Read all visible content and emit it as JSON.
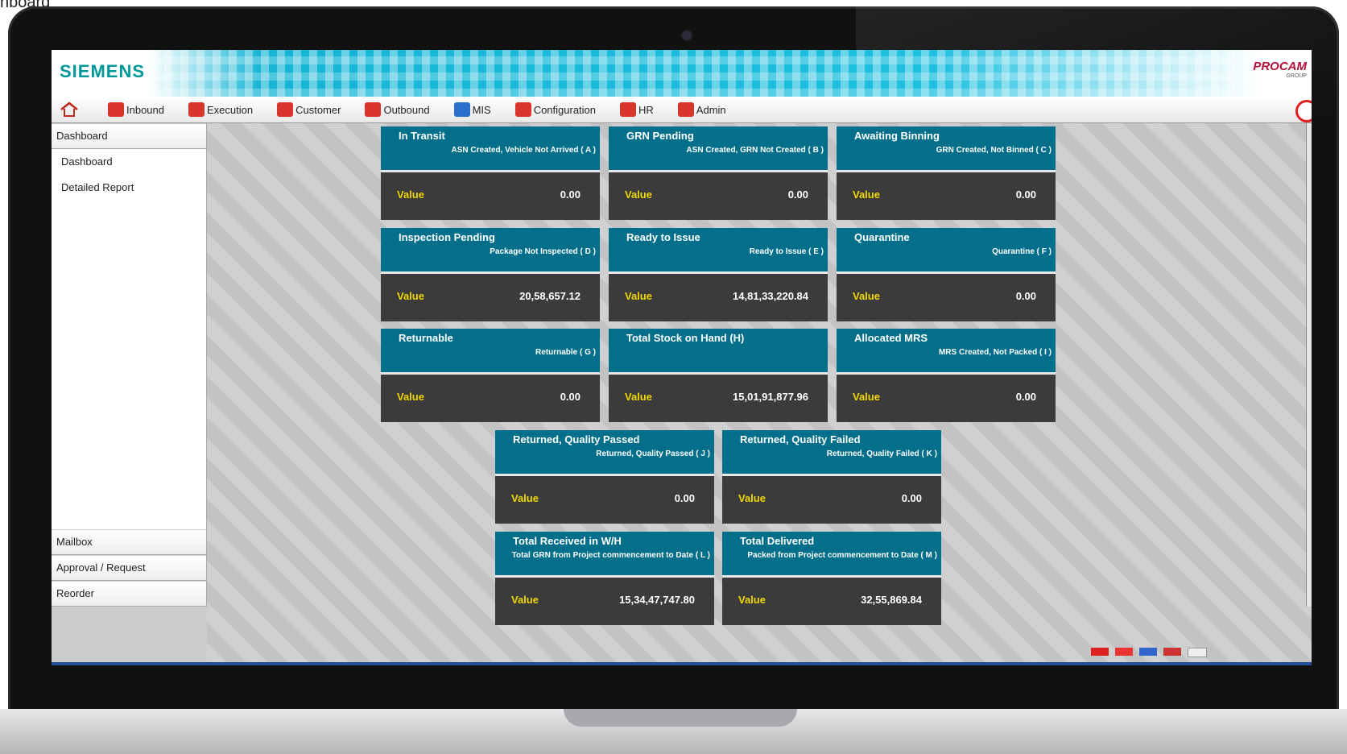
{
  "caption": "nboard",
  "app": {
    "brand_left": "SIEMENS",
    "brand_right": "PROCAM",
    "brand_right_sub": "GROUP"
  },
  "menu": {
    "items": [
      {
        "label": "Inbound",
        "icon": "truck-icon",
        "color": "#d9342b"
      },
      {
        "label": "Execution",
        "icon": "execution-icon",
        "color": "#d9342b"
      },
      {
        "label": "Customer",
        "icon": "users-icon",
        "color": "#d9342b"
      },
      {
        "label": "Outbound",
        "icon": "outbound-icon",
        "color": "#d9342b"
      },
      {
        "label": "MIS",
        "icon": "bar-chart-icon",
        "color": "#2a6fc9"
      },
      {
        "label": "Configuration",
        "icon": "user-config-icon",
        "color": "#d9342b"
      },
      {
        "label": "HR",
        "icon": "hr-users-icon",
        "color": "#d9342b"
      },
      {
        "label": "Admin",
        "icon": "admin-user-icon",
        "color": "#d9342b"
      }
    ]
  },
  "sidebar": {
    "header": "Dashboard",
    "links": [
      "Dashboard",
      "Detailed Report"
    ],
    "bottom": [
      "Mailbox",
      "Approval / Request",
      "Reorder"
    ]
  },
  "value_label": "Value",
  "cards": [
    {
      "title": "In Transit",
      "sub": "ASN Created, Vehicle Not Arrived ( A )",
      "value": "0.00"
    },
    {
      "title": "GRN Pending",
      "sub": "ASN Created, GRN Not Created ( B )",
      "value": "0.00"
    },
    {
      "title": "Awaiting Binning",
      "sub": "GRN Created, Not Binned ( C )",
      "value": "0.00"
    },
    {
      "title": "Inspection Pending",
      "sub": "Package Not Inspected ( D )",
      "value": "20,58,657.12"
    },
    {
      "title": "Ready to Issue",
      "sub": "Ready to Issue ( E )",
      "value": "14,81,33,220.84"
    },
    {
      "title": "Quarantine",
      "sub": "Quarantine ( F )",
      "value": "0.00"
    },
    {
      "title": "Returnable",
      "sub": "Returnable ( G )",
      "value": "0.00"
    },
    {
      "title": "Total Stock on Hand (H)",
      "sub": "",
      "value": "15,01,91,877.96"
    },
    {
      "title": "Allocated MRS",
      "sub": "MRS Created, Not Packed ( I )",
      "value": "0.00"
    },
    {
      "title": "Returned, Quality Passed",
      "sub": "Returned, Quality Passed ( J )",
      "value": "0.00"
    },
    {
      "title": "Returned, Quality Failed",
      "sub": "Returned, Quality Failed ( K )",
      "value": "0.00"
    },
    {
      "title": "Total Received in W/H",
      "sub": "Total GRN from Project commencement to Date ( L )",
      "value": "15,34,47,747.80"
    },
    {
      "title": "Total Delivered",
      "sub": "Packed from Project commencement to Date ( M )",
      "value": "32,55,869.84"
    }
  ]
}
